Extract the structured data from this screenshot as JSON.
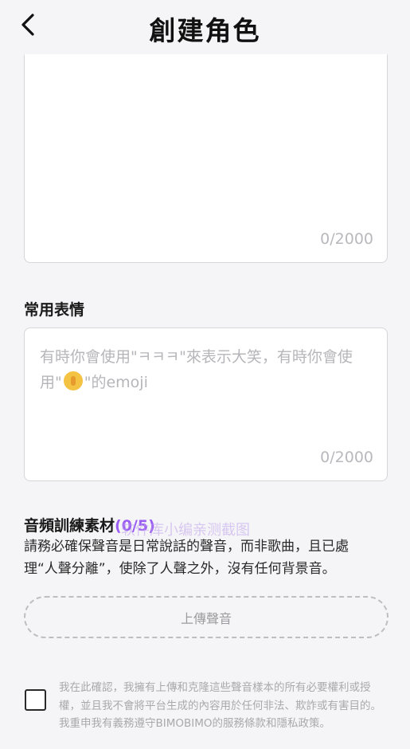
{
  "header": {
    "title": "創建角色",
    "back_icon": "chevron-left-icon"
  },
  "description_box": {
    "counter": "0/2000"
  },
  "expressions": {
    "label": "常用表情",
    "placeholder_before_emoji": "有時你會使用\"ㅋㅋㅋ\"來表示大笑，有時你會使用\"",
    "placeholder_after_emoji": "\"的emoji",
    "emoji_icon": "pleading-face-emoji-icon",
    "counter": "0/2000"
  },
  "audio": {
    "label": "音頻訓練素材",
    "count": "(0/5)",
    "description": "請務必確保聲音是日常說話的聲音，而非歌曲，且已處理“人聲分離”，使除了人聲之外，沒有任何背景音。",
    "upload_label": "上傳聲音"
  },
  "consent": {
    "text": "我在此確認，我擁有上傳和克隆這些聲音樣本的所有必要權利或授權，並且我不會將平台生成的內容用於任何非法、欺詐或有害目的。我重申我有義務遵守BIMOBIMO的服務條款和隱私政策。"
  },
  "watermark": "软件库小编亲测截图",
  "colors": {
    "accent": "#9a5cf2",
    "background": "#f5f5f7"
  }
}
